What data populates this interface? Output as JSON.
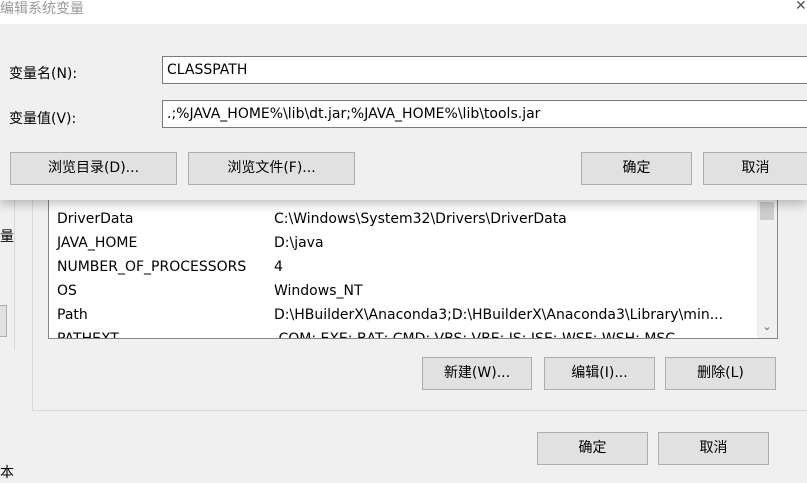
{
  "dialog": {
    "title": "编辑系统变量",
    "name_label": "变量名(N):",
    "name_value": "CLASSPATH",
    "value_label": "变量值(V):",
    "value_value": ".;%JAVA_HOME%\\lib\\dt.jar;%JAVA_HOME%\\lib\\tools.jar",
    "browse_dir": "浏览目录(D)...",
    "browse_file": "浏览文件(F)...",
    "ok": "确定",
    "cancel": "取消"
  },
  "background": {
    "left_label": "量",
    "left_bottom": "本",
    "system_vars": [
      {
        "name": "DriverData",
        "value": "C:\\Windows\\System32\\Drivers\\DriverData"
      },
      {
        "name": "JAVA_HOME",
        "value": "D:\\java"
      },
      {
        "name": "NUMBER_OF_PROCESSORS",
        "value": "4"
      },
      {
        "name": "OS",
        "value": "Windows_NT"
      },
      {
        "name": "Path",
        "value": "D:\\HBuilderX\\Anaconda3;D:\\HBuilderX\\Anaconda3\\Library\\min..."
      },
      {
        "name": "PATHEXT",
        "value": ".COM;.EXE;.BAT;.CMD;.VBS;.VBE;.JS;.JSE;.WSF;.WSH;.MSC"
      }
    ],
    "new_button": "新建(W)...",
    "edit_button": "编辑(I)...",
    "delete_button": "删除(L)",
    "ok": "确定",
    "cancel": "取消"
  }
}
